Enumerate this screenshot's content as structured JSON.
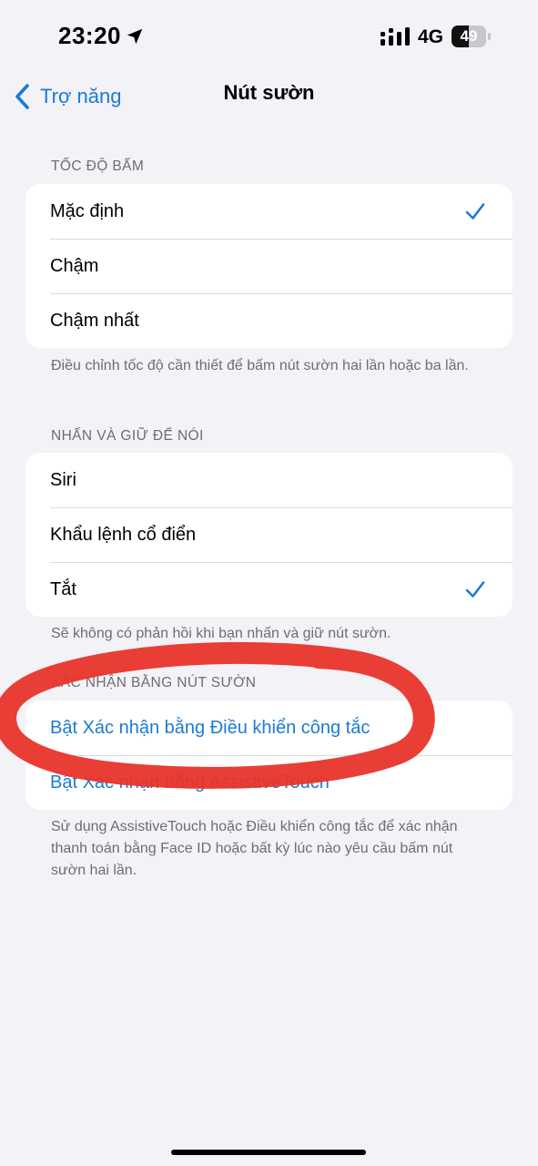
{
  "status_bar": {
    "time": "23:20",
    "network": "4G",
    "battery_level": "49",
    "battery_fraction": 0.49
  },
  "nav": {
    "back_label": "Trợ năng",
    "title": "Nút sườn"
  },
  "section_speed": {
    "header": "TỐC ĐỘ BẤM",
    "items": [
      {
        "label": "Mặc định",
        "selected": true
      },
      {
        "label": "Chậm",
        "selected": false
      },
      {
        "label": "Chậm nhất",
        "selected": false
      }
    ],
    "footer": "Điều chỉnh tốc độ cần thiết để bấm nút sườn hai lần hoặc ba lần."
  },
  "section_hold": {
    "header": "NHẤN VÀ GIỮ ĐỂ NÓI",
    "items": [
      {
        "label": "Siri",
        "selected": false
      },
      {
        "label": "Khẩu lệnh cổ điển",
        "selected": false
      },
      {
        "label": "Tắt",
        "selected": true
      }
    ],
    "footer": "Sẽ không có phản hồi khi bạn nhấn và giữ nút sườn."
  },
  "section_confirm": {
    "header": "XÁC NHẬN BẰNG NÚT SƯỜN",
    "items": [
      {
        "label": "Bật Xác nhận bằng Điều khiển công tắc"
      },
      {
        "label": "Bật Xác nhận bằng AssistiveTouch"
      }
    ],
    "footer": "Sử dụng AssistiveTouch hoặc Điều khiển công tắc để xác nhận thanh toán bằng Face ID hoặc bất kỳ lúc nào yêu cầu bấm nút sườn hai lần."
  },
  "colors": {
    "accent": "#1b7bd6",
    "background": "#f2f2f7",
    "annotation": "#e8342a"
  },
  "icons": {
    "location": "location-arrow-icon",
    "signal": "cellular-signal-icon",
    "back": "chevron-left-icon",
    "check": "checkmark-icon"
  }
}
